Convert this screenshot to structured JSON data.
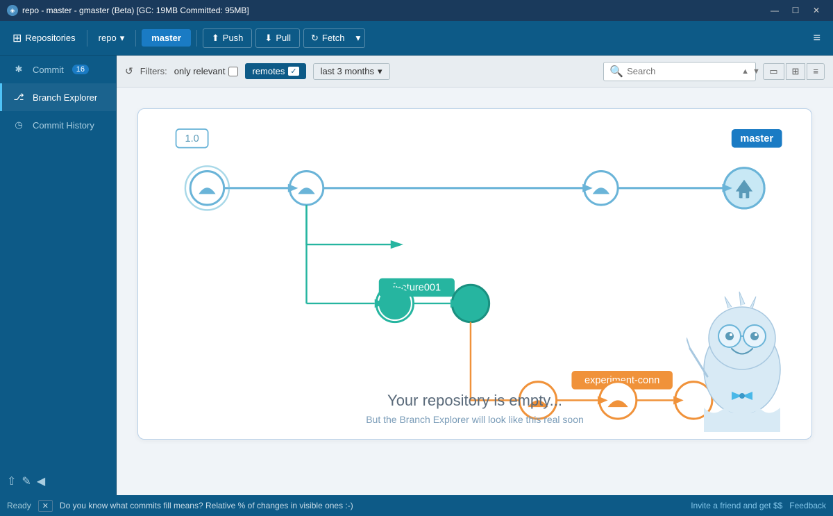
{
  "titlebar": {
    "title": "repo - master - gmaster (Beta) [GC: 19MB Committed: 95MB]",
    "icon": "◈",
    "minimize": "—",
    "maximize": "☐",
    "close": "✕"
  },
  "toolbar": {
    "repo_icon": "⊞",
    "repositories_label": "Repositories",
    "repo_label": "repo",
    "repo_arrow": "▾",
    "branch_label": "master",
    "push_label": "Push",
    "pull_label": "Pull",
    "fetch_label": "Fetch",
    "fetch_arrow": "▾",
    "menu_icon": "≡"
  },
  "sidebar": {
    "items": [
      {
        "id": "commit",
        "label": "Commit",
        "badge": "16",
        "icon": "✱"
      },
      {
        "id": "branch-explorer",
        "label": "Branch Explorer",
        "badge": null,
        "icon": "⎇"
      },
      {
        "id": "commit-history",
        "label": "Commit History",
        "badge": null,
        "icon": "◷"
      }
    ],
    "bottom": {
      "icon1": "⇧",
      "icon2": "✎",
      "icon3": "◀"
    }
  },
  "filterbar": {
    "refresh_icon": "↺",
    "filters_label": "Filters:",
    "only_relevant_label": "only relevant",
    "remotes_label": "remotes",
    "remotes_checked": true,
    "last3months_label": "last 3 months",
    "last3months_arrow": "▾",
    "search_placeholder": "Search",
    "nav_up": "▲",
    "nav_down": "▼",
    "view_single": "▭",
    "view_double": "▯▯",
    "view_list": "≡"
  },
  "diagram": {
    "tag_10": "1.0",
    "branch_master": "master",
    "branch_feature001": "feature001",
    "branch_experiment": "experiment-conn"
  },
  "empty_state": {
    "title": "Your repository is empty...",
    "subtitle": "But the Branch Explorer will look like this real soon"
  },
  "statusbar": {
    "ready": "Ready",
    "close_icon": "✕",
    "message": "Do you know what commits fill means? Relative % of changes in visible ones :-)",
    "invite_link": "Invite a friend and get $$",
    "feedback_link": "Feedback"
  }
}
